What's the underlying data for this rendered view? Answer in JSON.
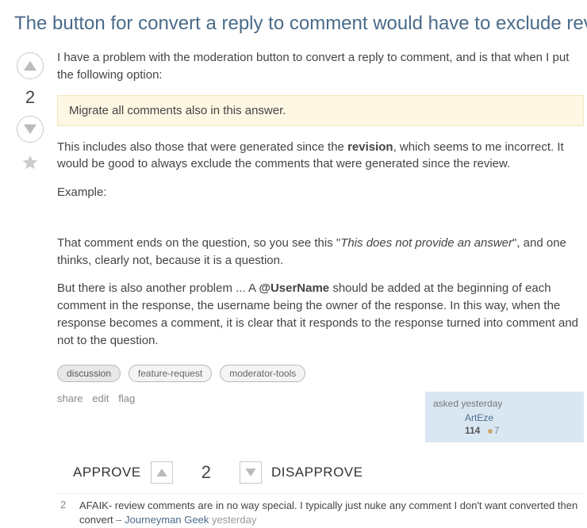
{
  "title": "The button for convert a reply to comment would have to exclude review comments",
  "vote": {
    "score": "2"
  },
  "post": {
    "p1": "I have a problem with the moderation button to convert a reply to comment, and is that when I put the following option:",
    "quote": "Migrate all comments also in this answer.",
    "p2_a": "This includes also those that were generated since the ",
    "p2_b": "revision",
    "p2_c": ", which seems to me incorrect. It would be good to always exclude the comments that were generated since the review.",
    "p3": "Example:",
    "p4_a": "That comment ends on the question, so you see this \"",
    "p4_b": "This does not provide an answer",
    "p4_c": "\", and one thinks, clearly not, because it is a question.",
    "p5_a": "But there is also another problem ... A ",
    "p5_b": "@UserName",
    "p5_c": " should be added at the beginning of each comment in the response, the username being the owner of the response. In this way, when the response becomes a comment, it is clear that it responds to the response turned into comment and not to the question."
  },
  "tags": [
    "discussion",
    "feature-request",
    "moderator-tools"
  ],
  "actions": {
    "share": "share",
    "edit": "edit",
    "flag": "flag"
  },
  "usercard": {
    "asked_label": "asked ",
    "asked_time": "yesterday",
    "username": "ArtEze",
    "rep": "114",
    "bronze": "7"
  },
  "suggested": {
    "approve": "APPROVE",
    "score": "2",
    "disapprove": "DISAPPROVE"
  },
  "comment": {
    "score": "2",
    "text": "AFAIK- review comments are in no way special. I typically just nuke any comment I don't want converted then convert",
    "dash": " – ",
    "author": "Journeyman Geek",
    "time": " yesterday"
  }
}
